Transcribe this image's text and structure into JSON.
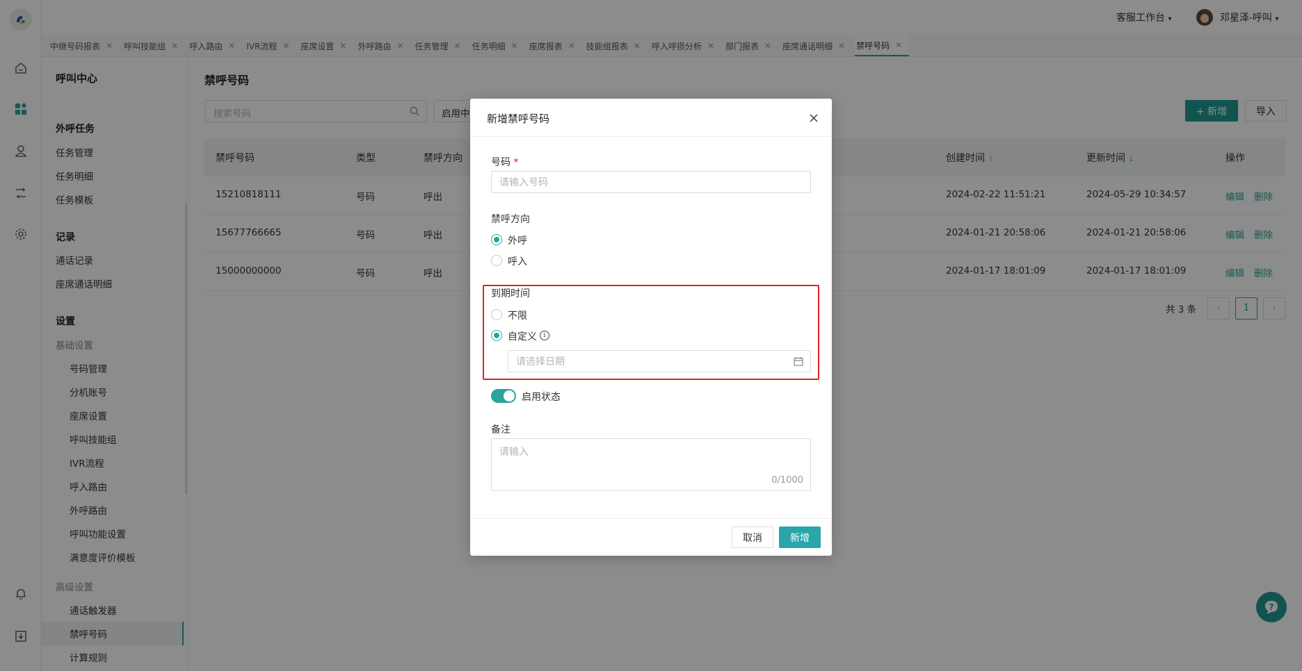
{
  "topbar": {
    "workspace": "客服工作台",
    "user_name": "邓星泽-呼叫"
  },
  "tabs": [
    "中继号码报表",
    "呼叫技能组",
    "呼入路由",
    "IVR流程",
    "座席设置",
    "外呼路由",
    "任务管理",
    "任务明细",
    "座席报表",
    "技能组报表",
    "呼入呼损分析",
    "部门报表",
    "座席通话明细",
    "禁呼号码"
  ],
  "sidebar": {
    "title": "呼叫中心",
    "sections": [
      {
        "label": "外呼任务",
        "items": [
          "任务管理",
          "任务明细",
          "任务模板"
        ]
      },
      {
        "label": "记录",
        "items": [
          "通话记录",
          "座席通话明细"
        ]
      },
      {
        "label": "设置"
      }
    ],
    "basic_group": "基础设置",
    "basic_items": [
      "号码管理",
      "分机账号",
      "座席设置",
      "呼叫技能组",
      "IVR流程",
      "呼入路由",
      "外呼路由",
      "呼叫功能设置",
      "满意度评价模板"
    ],
    "advanced_group": "高级设置",
    "advanced_items": [
      "通话触发器",
      "禁呼号码",
      "计算规则"
    ]
  },
  "page": {
    "title": "禁呼号码",
    "search_placeholder": "搜索号码",
    "status_filter": "启用中",
    "add_button": "+ 新增",
    "import_button": "导入",
    "columns": {
      "number": "禁呼号码",
      "type": "类型",
      "direction": "禁呼方向",
      "created": "创建时间",
      "updated": "更新时间",
      "actions": "操作"
    },
    "rows": [
      {
        "number": "15210818111",
        "type": "号码",
        "direction": "呼出",
        "created": "2024-02-22 11:51:21",
        "updated": "2024-05-29 10:34:57",
        "edit": "编辑",
        "delete": "删除"
      },
      {
        "number": "15677766665",
        "type": "号码",
        "direction": "呼出",
        "created": "2024-01-21 20:58:06",
        "updated": "2024-01-21 20:58:06",
        "edit": "编辑",
        "delete": "删除"
      },
      {
        "number": "15000000000",
        "type": "号码",
        "direction": "呼出",
        "created": "2024-01-17 18:01:09",
        "updated": "2024-01-17 18:01:09",
        "edit": "编辑",
        "delete": "删除"
      }
    ],
    "total": "共 3 条",
    "current_page": "1"
  },
  "modal": {
    "title": "新增禁呼号码",
    "number_label": "号码",
    "required_mark": "*",
    "number_placeholder": "请输入号码",
    "direction_label": "禁呼方向",
    "direction_options": [
      "外呼",
      "呼入"
    ],
    "direction_selected": "外呼",
    "expiry_label": "到期时间",
    "expiry_options": [
      "不限",
      "自定义"
    ],
    "expiry_selected": "自定义",
    "date_placeholder": "请选择日期",
    "status_label": "启用状态",
    "status_enabled": true,
    "remark_label": "备注",
    "remark_placeholder": "请输入",
    "remark_counter": "0/1000",
    "cancel_button": "取消",
    "submit_button": "新增"
  },
  "colors": {
    "accent": "#2aa59c",
    "highlight_border": "#e02020"
  }
}
